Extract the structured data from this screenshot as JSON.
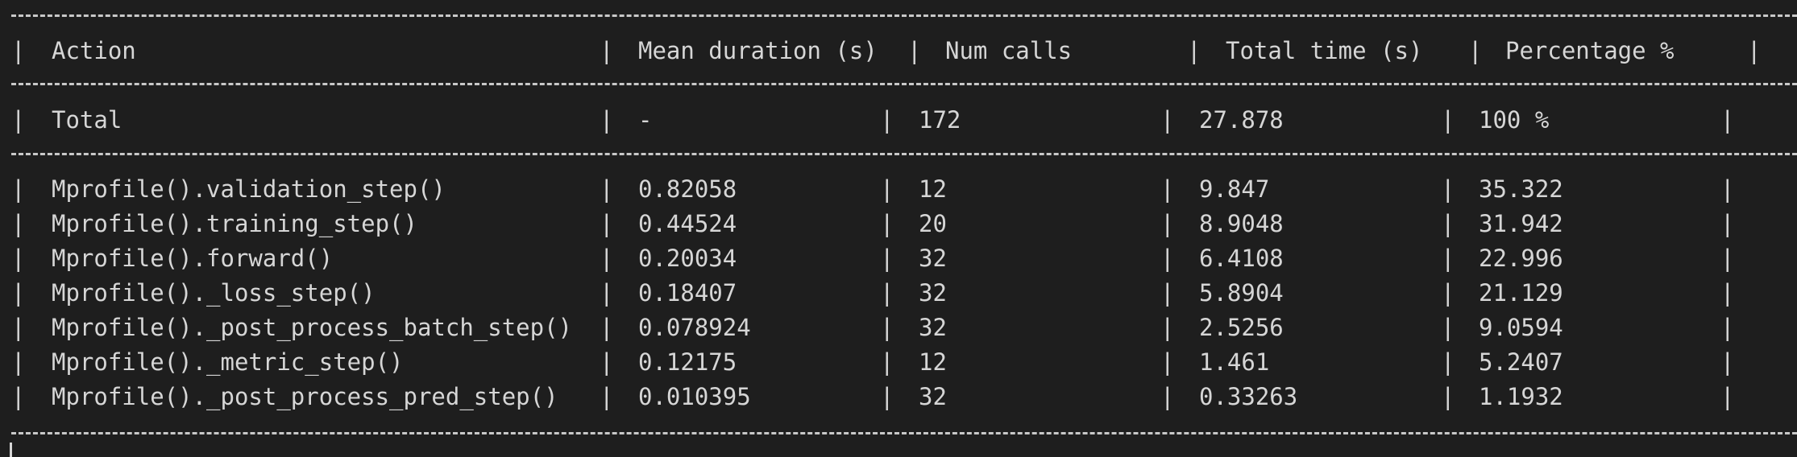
{
  "header": {
    "action": "Action",
    "mean": "Mean duration (s)",
    "calls": "Num calls",
    "total": "Total time (s)",
    "pct": "Percentage %"
  },
  "total_row": {
    "action": "Total",
    "mean": "-",
    "calls": "172",
    "total": "27.878",
    "pct": "100 %"
  },
  "rows": [
    {
      "action": "Mprofile().validation_step()",
      "mean": "0.82058",
      "calls": "12",
      "total": "9.847",
      "pct": "35.322"
    },
    {
      "action": "Mprofile().training_step()",
      "mean": "0.44524",
      "calls": "20",
      "total": "8.9048",
      "pct": "31.942"
    },
    {
      "action": "Mprofile().forward()",
      "mean": "0.20034",
      "calls": "32",
      "total": "6.4108",
      "pct": "22.996"
    },
    {
      "action": "Mprofile()._loss_step()",
      "mean": "0.18407",
      "calls": "32",
      "total": "5.8904",
      "pct": "21.129"
    },
    {
      "action": "Mprofile()._post_process_batch_step()",
      "mean": "0.078924",
      "calls": "32",
      "total": "2.5256",
      "pct": "9.0594"
    },
    {
      "action": "Mprofile()._metric_step()",
      "mean": "0.12175",
      "calls": "12",
      "total": "1.461",
      "pct": "5.2407"
    },
    {
      "action": "Mprofile()._post_process_pred_step()",
      "mean": "0.010395",
      "calls": "32",
      "total": "0.33263",
      "pct": "1.1932"
    }
  ],
  "glyphs": {
    "column_bar": "|"
  }
}
